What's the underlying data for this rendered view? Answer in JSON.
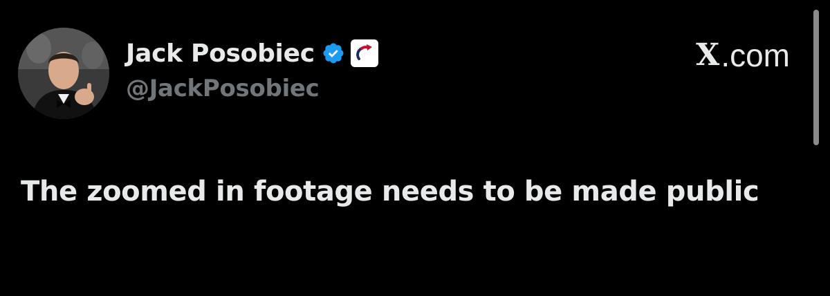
{
  "author": {
    "display_name": "Jack Posobiec",
    "handle": "@JackPosobiec",
    "verified_icon": "verified-badge-icon",
    "affiliate_icon": "affiliate-badge-icon"
  },
  "source": {
    "logo": "X",
    "domain": ".com"
  },
  "tweet": {
    "text": "The zoomed in footage needs to be made public"
  },
  "colors": {
    "background": "#000000",
    "text": "#e7e9ea",
    "handle": "#71767b",
    "verified": "#1d9bf0",
    "affiliate_accent": "#c8102e"
  }
}
